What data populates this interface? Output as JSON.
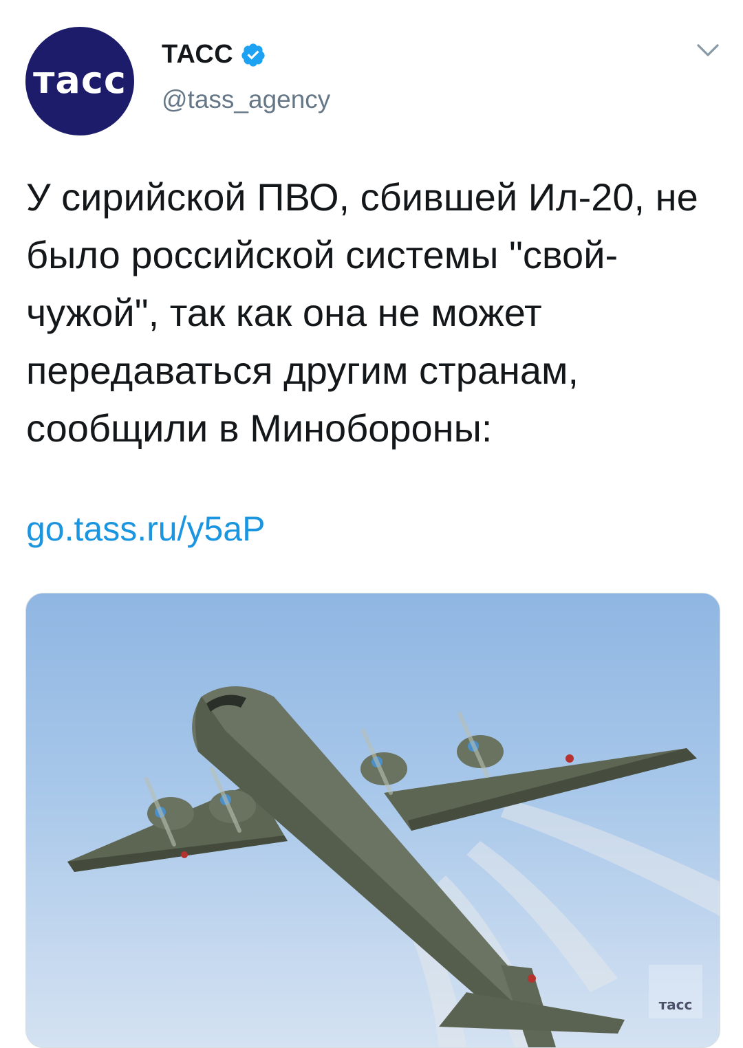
{
  "account": {
    "avatar_logo_text": "тасс",
    "display_name": "ТАСС",
    "handle": "@tass_agency",
    "verified": true
  },
  "tweet": {
    "text": "У сирийской ПВО, сбившей Ил-20, не было российской системы \"свой-чужой\", так как она не может передаваться другим странам, сообщили в Минобороны:",
    "link": "go.tass.ru/y5aP"
  },
  "media": {
    "watermark_text": "тасс"
  },
  "colors": {
    "text": "#14171a",
    "secondary": "#657786",
    "link": "#1b95e0",
    "verified": "#1da1f2",
    "avatar_bg": "#1c1c6b"
  },
  "icons": {
    "verified": "verified-badge-icon",
    "caret": "chevron-down-icon"
  }
}
